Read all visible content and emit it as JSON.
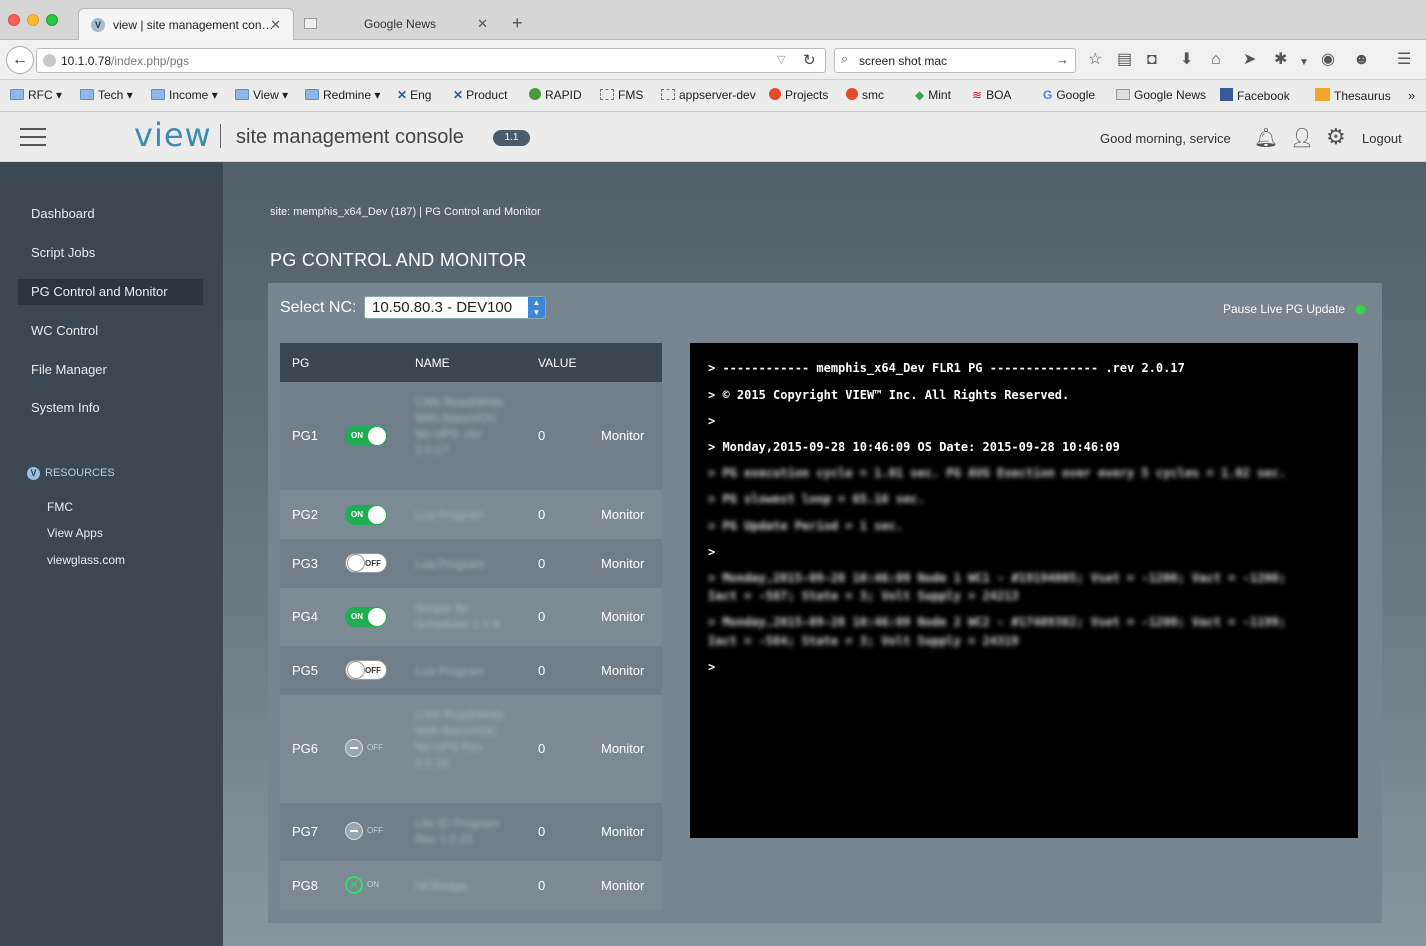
{
  "browser": {
    "tabs": [
      {
        "title": "view | site management con…",
        "active": true
      },
      {
        "title": "Google News",
        "active": false
      }
    ],
    "url_host": "10.1.0.78",
    "url_path": "/index.php/pgs",
    "search_value": "screen shot mac",
    "bookmarks": [
      "RFC",
      "Tech",
      "Income",
      "View",
      "Redmine",
      "Eng",
      "Product",
      "RAPID",
      "FMS",
      "appserver-dev",
      "Projects",
      "smc",
      "Mint",
      "BOA",
      "Google",
      "Google News",
      "Facebook",
      "Thesaurus"
    ]
  },
  "header": {
    "logo": "view",
    "title": "site management console",
    "version": "1.1",
    "greeting": "Good morning, service",
    "logout": "Logout"
  },
  "sidebar": {
    "items": [
      "Dashboard",
      "Script Jobs",
      "PG Control and Monitor",
      "WC Control",
      "File Manager",
      "System Info"
    ],
    "active": "PG Control and Monitor",
    "resources_title": "RESOURCES",
    "resources": [
      "FMC",
      "View Apps",
      "viewglass.com"
    ]
  },
  "main": {
    "breadcrumb": "site: memphis_x64_Dev (187)  | PG Control and Monitor",
    "title": "PG CONTROL AND MONITOR",
    "select_label": "Select NC:",
    "select_value": "10.50.80.3 - DEV100",
    "pause_label": "Pause Live PG Update",
    "table": {
      "headers": [
        "PG",
        "NAME",
        "VALUE"
      ],
      "rows": [
        {
          "pg": "PG1",
          "state": "ON",
          "name": "CAN Read/Write With NanoVOC No UPS .rev 2.0.17",
          "value": "0",
          "action": "Monitor"
        },
        {
          "pg": "PG2",
          "state": "ON",
          "name": "Lua Program",
          "value": "0",
          "action": "Monitor"
        },
        {
          "pg": "PG3",
          "state": "OFF",
          "name": "Lua Program",
          "value": "0",
          "action": "Monitor"
        },
        {
          "pg": "PG4",
          "state": "ON",
          "name": "Simple ftp Scheduler 1.0.9",
          "value": "0",
          "action": "Monitor"
        },
        {
          "pg": "PG5",
          "state": "OFF",
          "name": "Lua Program",
          "value": "0",
          "action": "Monitor"
        },
        {
          "pg": "PG6",
          "state": "OFF",
          "name": "CAN Read/Write With NanoVOC No UPS Rev 2.0.18",
          "value": "0",
          "action": "Monitor"
        },
        {
          "pg": "PG7",
          "state": "OFF",
          "name": "Lite ID Program Rev 1.0.22",
          "value": "0",
          "action": "Monitor"
        },
        {
          "pg": "PG8",
          "state": "ON",
          "name": "NCBridge",
          "value": "0",
          "action": "Monitor"
        }
      ]
    },
    "console_lines": [
      "> ------------ memphis_x64_Dev FLR1 PG --------------- .rev 2.0.17",
      "> © 2015 Copyright VIEW™ Inc. All Rights Reserved.",
      ">",
      "> Monday,2015-09-28 10:46:09 OS Date: 2015-09-28 10:46:09",
      "> PG execution cycle = 1.01 sec. PG AVG Exection over every 5 cycles = 1.02 sec.",
      "> PG slowest loop = 65.16 sec.",
      "> PG Update Period = 1 sec.",
      ">",
      "> Monday,2015-09-28 10:46:09 Node 1 WC1 - #19194005; Vset = -1200; Vact = -1200;",
      "Iact = -587; State = 3; Volt Supply = 24213",
      "> Monday,2015-09-28 10:46:09 Node 2 WC2 - #17489382; Vset = -1200; Vact = -1199;",
      "Iact = -584; State = 3; Volt Supply = 24319",
      ">"
    ]
  }
}
